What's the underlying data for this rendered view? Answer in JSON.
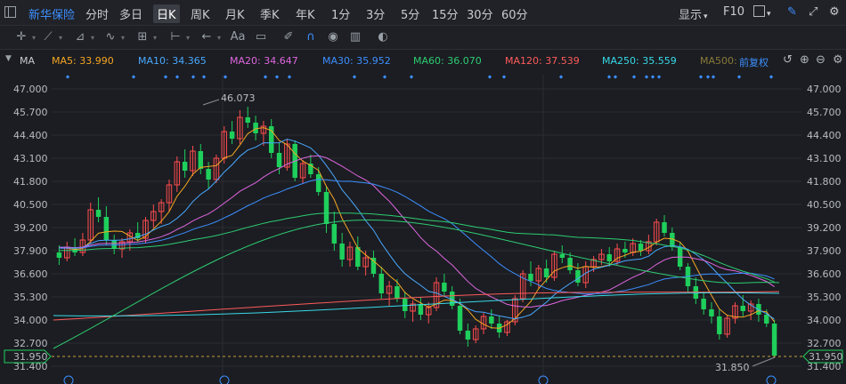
{
  "header": {
    "stock_name": "新华保险",
    "periods": [
      "分时",
      "多日",
      "日K",
      "周K",
      "月K",
      "季K",
      "年K",
      "1分",
      "3分",
      "5分",
      "15分",
      "30分",
      "60分"
    ],
    "active_period": "日K",
    "display_label": "显示",
    "f10_label": "F10"
  },
  "toolbar": {
    "text_tool_label": "Aa",
    "icons": [
      "crosshair-icon",
      "line-icon",
      "channel-icon",
      "wave-icon",
      "measure-icon",
      "range-icon",
      "arrow-icon",
      "text-icon",
      "comment-icon",
      "eraser-icon",
      "magnet-icon",
      "eye-icon",
      "trash-icon",
      "toggle-icon"
    ]
  },
  "indicator": {
    "name": "MA",
    "items": [
      {
        "label": "MA5: 33.990",
        "color": "#f5a623"
      },
      {
        "label": "MA10: 34.365",
        "color": "#4aa8ff"
      },
      {
        "label": "MA20: 34.647",
        "color": "#e066e0"
      },
      {
        "label": "MA30: 35.952",
        "color": "#3d8fff"
      },
      {
        "label": "MA60: 36.070",
        "color": "#2ecc71"
      },
      {
        "label": "MA120: 37.539",
        "color": "#ff5b5b"
      },
      {
        "label": "MA250: 35.559",
        "color": "#38d9e8"
      },
      {
        "label": "MA500:",
        "color": "#8a7a3a"
      }
    ],
    "adjust_label": "前复权"
  },
  "axis": {
    "price_labels": [
      "47.000",
      "45.700",
      "44.400",
      "43.100",
      "41.800",
      "40.500",
      "39.200",
      "37.900",
      "36.600",
      "35.300",
      "34.000",
      "32.700",
      "31.400"
    ],
    "current_price": "31.950",
    "high_label": "46.073",
    "low_label": "31.850",
    "ylim": [
      31.4,
      47.0
    ]
  },
  "colors": {
    "up": "#ff4d4f",
    "down": "#1fcf5c",
    "bg": "#1b1d22"
  },
  "chart_data": {
    "type": "candlestick",
    "candles": [
      [
        37.8,
        38.2,
        37.1,
        37.5
      ],
      [
        37.5,
        38.4,
        37.3,
        38.1
      ],
      [
        38.1,
        38.6,
        37.6,
        37.8
      ],
      [
        37.8,
        38.9,
        37.6,
        38.5
      ],
      [
        38.5,
        40.6,
        38.3,
        40.2
      ],
      [
        40.2,
        40.9,
        39.5,
        39.8
      ],
      [
        39.8,
        40.4,
        38.2,
        38.5
      ],
      [
        38.5,
        38.8,
        37.7,
        38.0
      ],
      [
        38.0,
        38.6,
        37.5,
        38.4
      ],
      [
        38.4,
        39.1,
        37.9,
        38.9
      ],
      [
        38.9,
        39.5,
        38.4,
        38.6
      ],
      [
        38.6,
        39.8,
        38.3,
        39.6
      ],
      [
        39.6,
        40.5,
        39.2,
        40.1
      ],
      [
        40.1,
        40.8,
        39.4,
        40.6
      ],
      [
        40.6,
        41.9,
        40.1,
        41.6
      ],
      [
        41.6,
        43.2,
        41.2,
        42.9
      ],
      [
        42.9,
        43.6,
        42.0,
        42.4
      ],
      [
        42.4,
        43.8,
        42.1,
        43.5
      ],
      [
        43.5,
        43.9,
        42.2,
        42.5
      ],
      [
        42.5,
        42.9,
        41.4,
        41.9
      ],
      [
        41.9,
        43.3,
        41.7,
        43.1
      ],
      [
        43.1,
        44.9,
        42.8,
        44.6
      ],
      [
        44.6,
        45.2,
        43.9,
        44.2
      ],
      [
        44.2,
        45.8,
        43.9,
        45.4
      ],
      [
        45.4,
        46.0,
        44.8,
        45.1
      ],
      [
        45.1,
        45.5,
        44.1,
        44.5
      ],
      [
        44.5,
        45.2,
        43.8,
        44.9
      ],
      [
        44.9,
        45.3,
        43.1,
        43.4
      ],
      [
        43.4,
        44.0,
        42.2,
        42.6
      ],
      [
        42.6,
        44.2,
        42.4,
        43.9
      ],
      [
        43.9,
        44.1,
        41.8,
        42.0
      ],
      [
        42.0,
        43.0,
        41.7,
        42.8
      ],
      [
        42.8,
        43.3,
        42.0,
        42.2
      ],
      [
        42.2,
        42.6,
        41.0,
        41.2
      ],
      [
        41.2,
        41.5,
        38.9,
        39.4
      ],
      [
        39.4,
        40.1,
        37.9,
        38.3
      ],
      [
        38.3,
        38.9,
        37.0,
        37.4
      ],
      [
        37.4,
        38.4,
        37.0,
        38.1
      ],
      [
        38.1,
        38.7,
        36.8,
        37.0
      ],
      [
        37.0,
        37.9,
        36.5,
        37.5
      ],
      [
        37.5,
        37.9,
        36.4,
        36.6
      ],
      [
        36.6,
        37.0,
        35.2,
        35.5
      ],
      [
        35.5,
        36.2,
        34.8,
        35.9
      ],
      [
        35.9,
        36.3,
        35.0,
        35.2
      ],
      [
        35.2,
        35.6,
        34.1,
        34.5
      ],
      [
        34.5,
        35.1,
        33.9,
        34.9
      ],
      [
        34.9,
        35.3,
        34.0,
        34.3
      ],
      [
        34.3,
        35.0,
        33.8,
        34.7
      ],
      [
        34.7,
        36.4,
        34.5,
        36.1
      ],
      [
        36.1,
        36.6,
        35.3,
        35.6
      ],
      [
        35.6,
        35.9,
        34.6,
        34.8
      ],
      [
        34.8,
        35.2,
        33.2,
        33.4
      ],
      [
        33.4,
        33.8,
        32.5,
        32.9
      ],
      [
        32.9,
        33.7,
        32.7,
        33.5
      ],
      [
        33.5,
        34.4,
        33.2,
        34.2
      ],
      [
        34.2,
        34.6,
        33.5,
        33.8
      ],
      [
        33.8,
        34.2,
        33.0,
        33.3
      ],
      [
        33.3,
        34.0,
        33.1,
        33.9
      ],
      [
        33.9,
        35.4,
        33.7,
        35.2
      ],
      [
        35.2,
        36.8,
        35.0,
        36.6
      ],
      [
        36.6,
        37.3,
        35.9,
        36.2
      ],
      [
        36.2,
        37.1,
        35.8,
        36.9
      ],
      [
        36.9,
        37.4,
        36.1,
        36.4
      ],
      [
        36.4,
        37.9,
        36.2,
        37.7
      ],
      [
        37.7,
        38.2,
        37.2,
        37.5
      ],
      [
        37.5,
        37.8,
        36.6,
        36.8
      ],
      [
        36.8,
        37.2,
        35.9,
        36.1
      ],
      [
        36.1,
        37.3,
        35.8,
        37.0
      ],
      [
        37.0,
        37.6,
        36.7,
        37.4
      ],
      [
        37.4,
        38.0,
        37.1,
        37.7
      ],
      [
        37.7,
        38.1,
        37.0,
        37.3
      ],
      [
        37.3,
        38.3,
        37.1,
        38.0
      ],
      [
        38.0,
        38.4,
        37.5,
        37.8
      ],
      [
        37.8,
        38.6,
        37.6,
        38.3
      ],
      [
        38.3,
        38.5,
        37.6,
        37.9
      ],
      [
        37.9,
        38.8,
        37.7,
        38.4
      ],
      [
        38.4,
        39.7,
        38.2,
        39.5
      ],
      [
        39.5,
        39.9,
        38.7,
        38.9
      ],
      [
        38.9,
        39.2,
        37.9,
        38.1
      ],
      [
        38.1,
        38.4,
        36.8,
        37.0
      ],
      [
        37.0,
        37.2,
        35.6,
        35.9
      ],
      [
        35.9,
        36.4,
        34.9,
        35.2
      ],
      [
        35.2,
        35.6,
        34.3,
        34.6
      ],
      [
        34.6,
        35.0,
        33.8,
        34.2
      ],
      [
        34.2,
        34.6,
        32.9,
        33.2
      ],
      [
        33.2,
        34.3,
        33.0,
        34.1
      ],
      [
        34.1,
        35.0,
        33.8,
        34.8
      ],
      [
        34.8,
        35.4,
        34.2,
        34.5
      ],
      [
        34.5,
        35.1,
        34.0,
        34.9
      ],
      [
        34.9,
        35.2,
        33.9,
        34.3
      ],
      [
        34.3,
        34.6,
        33.6,
        33.8
      ],
      [
        33.8,
        34.0,
        31.9,
        32.0
      ]
    ]
  }
}
